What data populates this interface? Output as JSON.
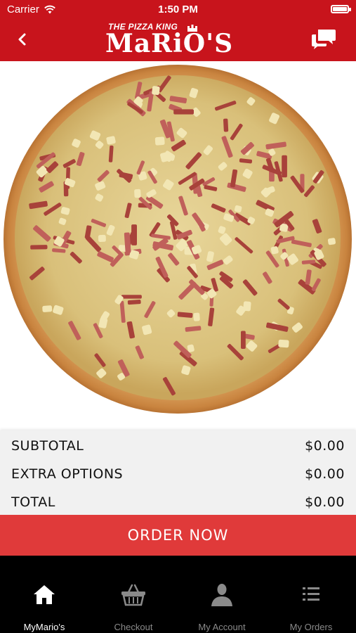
{
  "status_bar": {
    "carrier": "Carrier",
    "time": "1:50 PM"
  },
  "header": {
    "logo_tagline": "THE PIZZA KING",
    "logo_name": "MaRiO'S",
    "back_icon": "chevron-left-icon",
    "chat_icon": "chat-bubbles-icon"
  },
  "product": {
    "image": "hawaiian-pizza-photo"
  },
  "summary": {
    "subtotal_label": "SUBTOTAL",
    "subtotal_value": "$0.00",
    "extra_label": "EXTRA OPTIONS",
    "extra_value": "$0.00",
    "total_label": "TOTAL",
    "total_value": "$0.00"
  },
  "order_button": "ORDER NOW",
  "tabs": [
    {
      "label": "MyMario's",
      "icon": "home-icon",
      "active": true
    },
    {
      "label": "Checkout",
      "icon": "basket-icon",
      "active": false
    },
    {
      "label": "My Account",
      "icon": "person-icon",
      "active": false
    },
    {
      "label": "My Orders",
      "icon": "list-icon",
      "active": false
    }
  ],
  "colors": {
    "header": "#c8141c",
    "order_button": "#e03a3a",
    "tabbar": "#000000",
    "summary_bg": "#f1f1f1"
  }
}
